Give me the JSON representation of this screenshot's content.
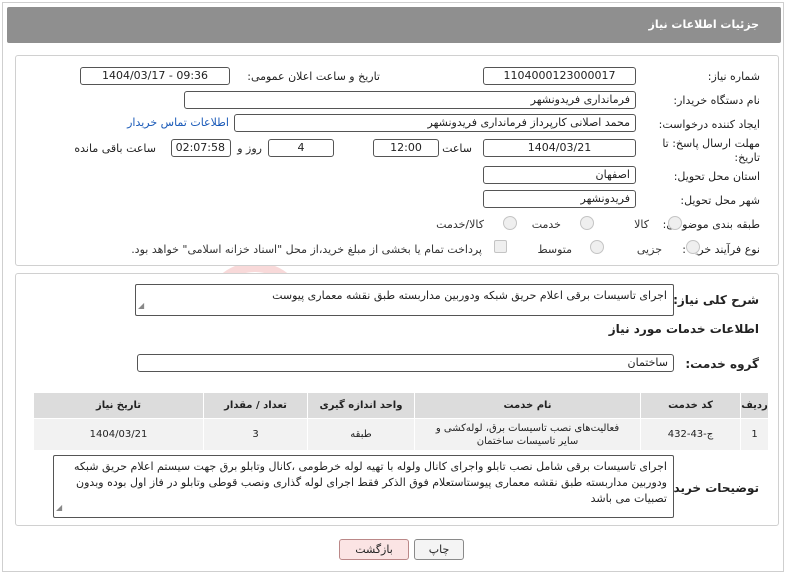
{
  "header": {
    "title": "جزئیات اطلاعات نیاز"
  },
  "form": {
    "need_number_label": "شماره نیاز:",
    "need_number": "1104000123000017",
    "announce_label": "تاریخ و ساعت اعلان عمومی:",
    "announce_value": "1404/03/17 - 09:36",
    "buyer_org_label": "نام دستگاه خریدار:",
    "buyer_org": "فرمانداری فریدونشهر",
    "requester_label": "ایجاد کننده درخواست:",
    "requester": "محمد اصلانی کارپرداز فرمانداری فریدونشهر",
    "contact_link": "اطلاعات تماس خریدار",
    "deadline_label": "مهلت ارسال پاسخ: تا تاریخ:",
    "deadline_date": "1404/03/21",
    "time_label": "ساعت",
    "deadline_time": "12:00",
    "days_value": "4",
    "days_label": "روز و",
    "remaining_time": "02:07:58",
    "remaining_label": "ساعت باقی مانده",
    "province_label": "استان محل تحویل:",
    "province": "اصفهان",
    "city_label": "شهر محل تحویل:",
    "city": "فریدونشهر",
    "category_label": "طبقه بندی موضوعی:",
    "category_options": [
      "کالا",
      "خدمت",
      "کالا/خدمت"
    ],
    "purchase_label": "نوع فرآیند خرید :",
    "purchase_options": [
      "جزیی",
      "متوسط"
    ],
    "payment_note": "پرداخت تمام یا بخشی از مبلغ خرید،از محل \"اسناد خزانه اسلامی\" خواهد بود."
  },
  "need": {
    "summary_label": "شرح کلی نیاز:",
    "summary": "اجرای تاسیسات برقی  اعلام حریق شبکه ودوربین مداربسته طبق نقشه معماری پیوست",
    "services_title": "اطلاعات خدمات مورد نیاز",
    "group_label": "گروه خدمت:",
    "group": "ساختمان"
  },
  "table": {
    "headers": [
      "ردیف",
      "کد خدمت",
      "نام خدمت",
      "واحد اندازه گیری",
      "تعداد / مقدار",
      "تاریخ نیاز"
    ],
    "rows": [
      [
        "1",
        "ج-43-432",
        "فعالیت‌های نصب تاسیسات برق، لوله‌کشی و سایر تاسیسات ساختمان",
        "طبقه",
        "3",
        "1404/03/21"
      ]
    ]
  },
  "buyer_notes": {
    "label": "توضیحات خریدار:",
    "text": "اجرای تاسیسات برقی شامل نصب تابلو واجرای کانال ولوله با تهیه لوله خرطومی ،کانال وتابلو برق جهت سیستم اعلام حریق شبکه ودوربین مداربسته طبق نقشه معماری پیوستاستعلام فوق الذکر فقط اجرای لوله گذاری ونصب قوطی وتابلو در فاز اول بوده وبدون تصبیات می باشد"
  },
  "buttons": {
    "print": "چاپ",
    "back": "بازگشت"
  },
  "colors": {
    "header_bg": "#8f8f8f",
    "link": "#1a5ab8",
    "back_bg": "#fbe4e4"
  }
}
